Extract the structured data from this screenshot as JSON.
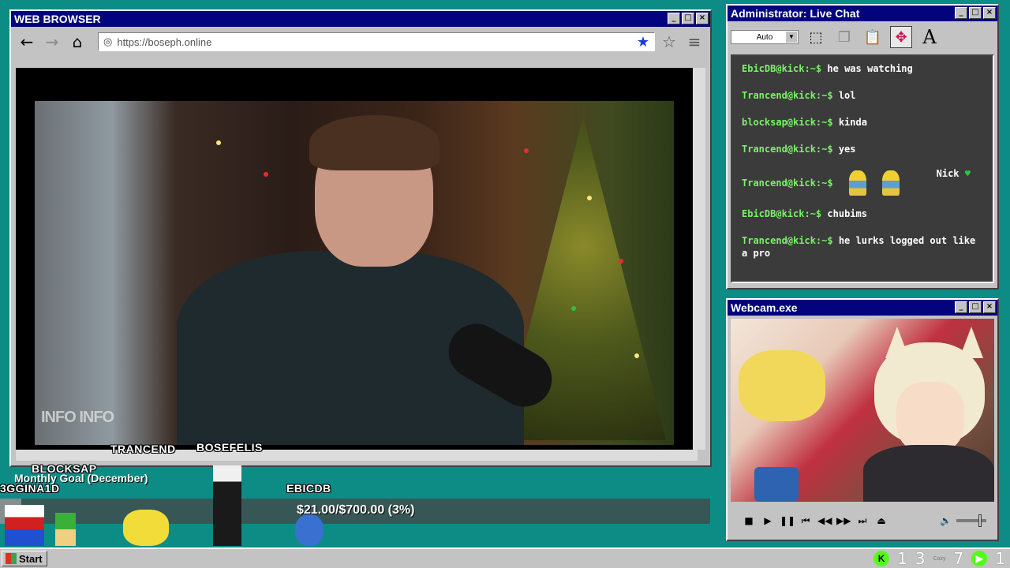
{
  "browser": {
    "title": "WEB BROWSER",
    "url": "https://boseph.online",
    "back_icon": "arrow-left-icon",
    "forward_icon": "arrow-right-icon",
    "home_icon": "home-icon",
    "bookmark_icon": "star-filled-icon",
    "favorite_icon": "star-outline-icon",
    "menu_icon": "hamburger-icon",
    "watermark": "INFO INFO"
  },
  "chat": {
    "title": "Administrator: Live Chat",
    "font_select": "Auto",
    "messages": [
      {
        "user": "EbicDB@kick:~$",
        "text": "he was watching"
      },
      {
        "user": "Trancend@kick:~$",
        "text": "lol"
      },
      {
        "user": "blocksap@kick:~$",
        "text": "kinda"
      },
      {
        "user": "Trancend@kick:~$",
        "text": "yes"
      },
      {
        "user": "Trancend@kick:~$",
        "text": "",
        "emotes": true,
        "nick": "Nick"
      },
      {
        "user": "EbicDB@kick:~$",
        "text": "chubims"
      },
      {
        "user": "Trancend@kick:~$",
        "text": "he lurks logged out like a pro"
      }
    ]
  },
  "webcam": {
    "title": "Webcam.exe"
  },
  "overlay": {
    "names": {
      "blocksap": "BLOCKSAP",
      "trancend": "TRANCEND",
      "bosefelis": "BOSEFELIS",
      "ebicdb": "EBICDB",
      "edge": "3GGINA1D"
    },
    "goal_title": "Monthly Goal (December)",
    "goal_text": "$21.00/$700.00 (3%)",
    "goal_progress_percent": 3
  },
  "taskbar": {
    "start_label": "Start",
    "tray_k": "K",
    "tray_num1": "1",
    "tray_num2": "3",
    "tray_small": "Cozy",
    "tray_num3": "7",
    "tray_num4": "1"
  },
  "colors": {
    "desktop": "#0d8c86",
    "titlebar": "#03037e",
    "chat_user": "#7cf16a",
    "kick_green": "#53fc18"
  }
}
